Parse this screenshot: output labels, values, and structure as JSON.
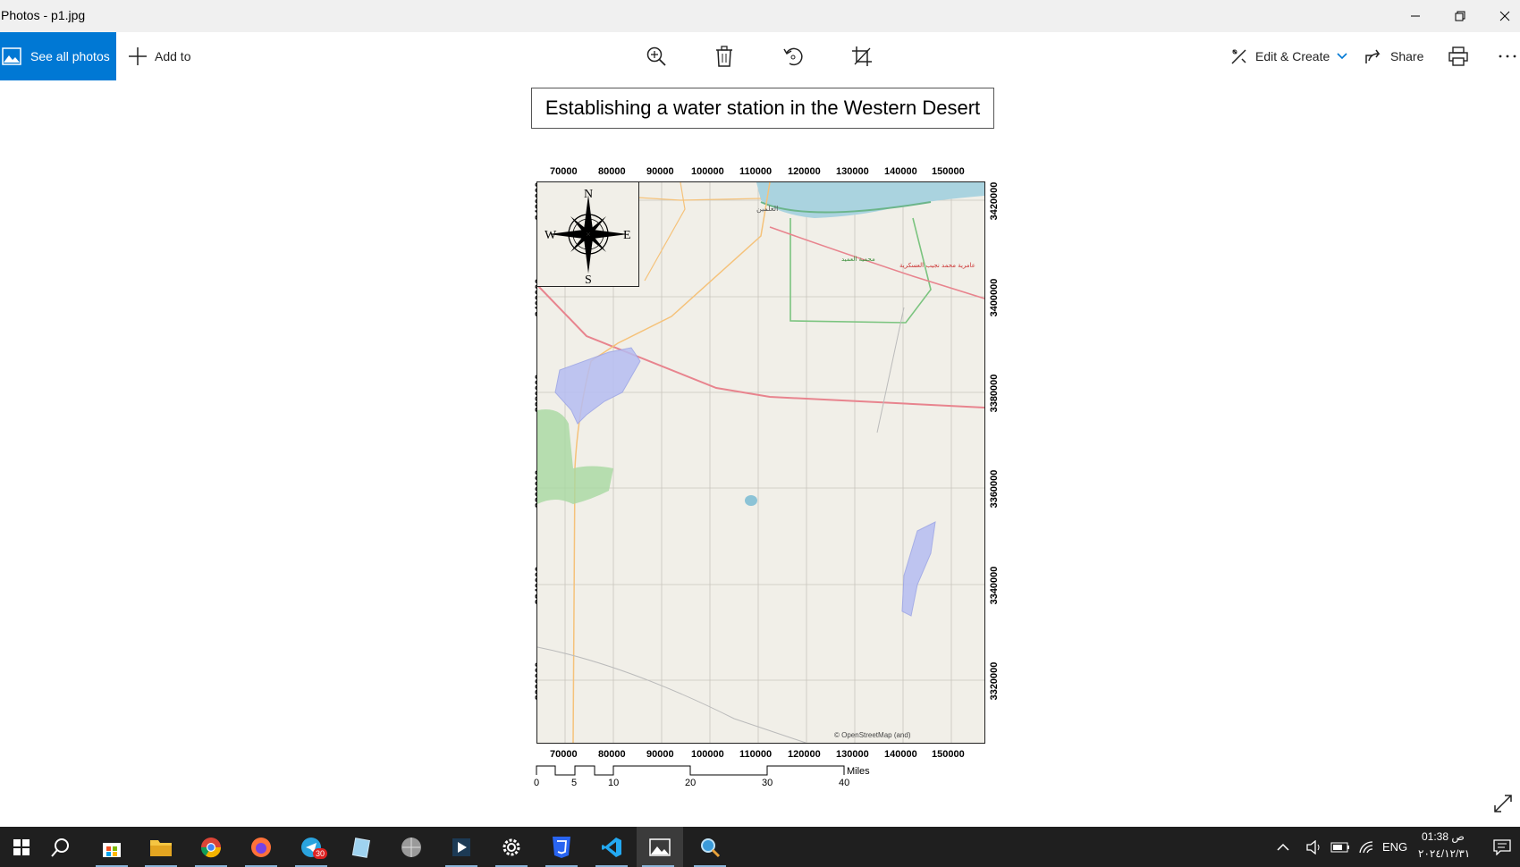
{
  "window": {
    "title": "Photos - p1.jpg"
  },
  "toolbar": {
    "see_all_label": "See all photos",
    "add_to_label": "Add to",
    "edit_create_label": "Edit & Create",
    "share_label": "Share",
    "icons": [
      "zoom-icon",
      "delete-icon",
      "rotate-icon",
      "crop-icon",
      "print-icon",
      "more-icon"
    ]
  },
  "map": {
    "title": "Establishing a water station in the Western Desert",
    "x_ticks": [
      "70000",
      "80000",
      "90000",
      "100000",
      "110000",
      "120000",
      "130000",
      "140000",
      "150000"
    ],
    "y_ticks": [
      "3420000",
      "3400000",
      "3380000",
      "3360000",
      "3340000",
      "3320000"
    ],
    "compass": {
      "n": "N",
      "s": "S",
      "e": "E",
      "w": "W"
    },
    "scale_labels": [
      "0",
      "5",
      "10",
      "20",
      "30",
      "40"
    ],
    "scale_unit": "Miles",
    "attribution": "© OpenStreetMap (and)",
    "place_labels": [
      "العلمين",
      "محمية العميد",
      "عامرية محمد نجيب العسكرية"
    ],
    "colors": {
      "sea": "#aad3df",
      "land": "#f1efe8",
      "road": "#e8848e",
      "minor_road": "#f5c27a",
      "reserve": "#7bc47f",
      "water_area": "#b6bdf2"
    }
  },
  "taskbar": {
    "icons": [
      "windows-start-icon",
      "search-icon",
      "store-icon",
      "file-explorer-icon",
      "chrome-icon",
      "firefox-icon",
      "telegram-icon",
      "notepad-icon",
      "globe-app-icon",
      "media-app-icon",
      "settings-icon",
      "css3-icon",
      "vscode-icon",
      "photos-icon",
      "search-app-icon"
    ],
    "telegram_badge": "30",
    "language": "ENG",
    "time": "01:38 ص",
    "date": "٢٠٢٤/١٢/٣١"
  }
}
